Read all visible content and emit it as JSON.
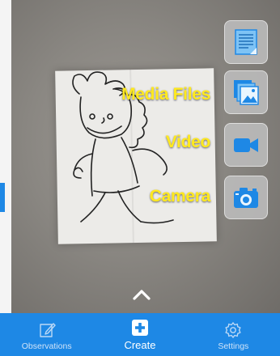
{
  "actions": {
    "media_files_label": "Media Files",
    "video_label": "Video",
    "camera_label": "Camera"
  },
  "icons": {
    "document": "document-icon",
    "media_files": "image-stack-icon",
    "video": "video-camera-icon",
    "camera": "camera-icon",
    "expand": "chevron-up-icon"
  },
  "bottom_nav": {
    "items": [
      {
        "label": "Observations",
        "icon": "pencil-note-icon"
      },
      {
        "label": "Create",
        "icon": "plus-square-icon"
      },
      {
        "label": "Settings",
        "icon": "gear-icon"
      }
    ],
    "active_index": 1
  },
  "colors": {
    "accent": "#1e88e5",
    "label": "#ffe91f"
  }
}
